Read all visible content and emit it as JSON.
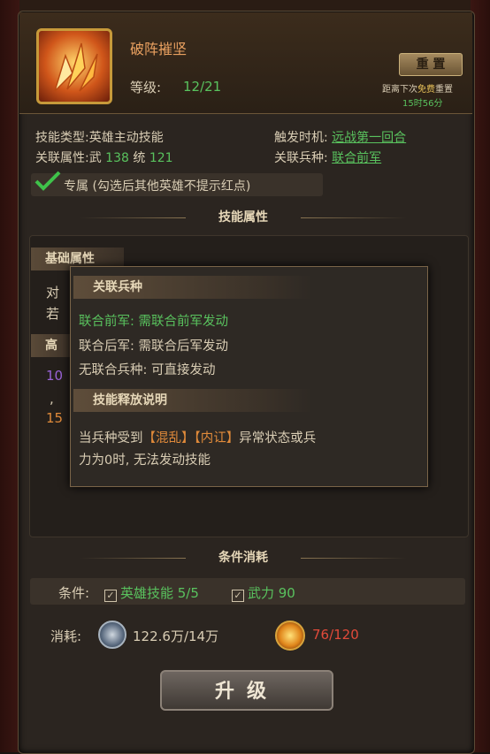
{
  "header": {
    "skill_name": "破阵摧坚",
    "level_label": "等级:",
    "level_value": "12/21",
    "reset_button": "重 置",
    "reset_note_prefix": "距离下次",
    "reset_note_free": "免费",
    "reset_note_suffix": "重置",
    "reset_time": "15时56分"
  },
  "info": {
    "type_label": "技能类型:",
    "type_value": "英雄主动技能",
    "attr_label": "关联属性:",
    "attr_value_a": "武",
    "attr_num_a": "138",
    "attr_value_b": "统",
    "attr_num_b": "121",
    "trigger_label": "触发时机:",
    "trigger_value": "远战第一回合",
    "troop_label": "关联兵种:",
    "troop_value": "联合前军"
  },
  "exclusive": {
    "label": "专属 (勾选后其他英雄不提示红点)"
  },
  "sections": {
    "attributes_title": "技能属性",
    "cost_title": "条件消耗"
  },
  "attributes": {
    "basic_head": "基础属性",
    "high_head": "高",
    "row1": "对",
    "row2": "若",
    "row3": "10",
    "row4": ",",
    "row5": "15"
  },
  "popup": {
    "head1": "关联兵种",
    "line1": "联合前军: 需联合前军发动",
    "line2": "联合后军: 需联合后军发动",
    "line3": "无联合兵种: 可直接发动",
    "head2": "技能释放说明",
    "desc_a": "当兵种受到",
    "desc_tag1": "【混乱】",
    "desc_tag2": "【内讧】",
    "desc_b": "异常状态或兵",
    "desc_c": "力为0时, 无法发动技能"
  },
  "conditions": {
    "label": "条件:",
    "cond1": "英雄技能 5/5",
    "cond2": "武力 90"
  },
  "cost": {
    "label": "消耗:",
    "silver": "122.6万/14万",
    "orb": "76/120"
  },
  "upgrade_button": "升级",
  "colors": {
    "green": "#59c25e",
    "red": "#e24a3a",
    "orange": "#e9a060"
  }
}
